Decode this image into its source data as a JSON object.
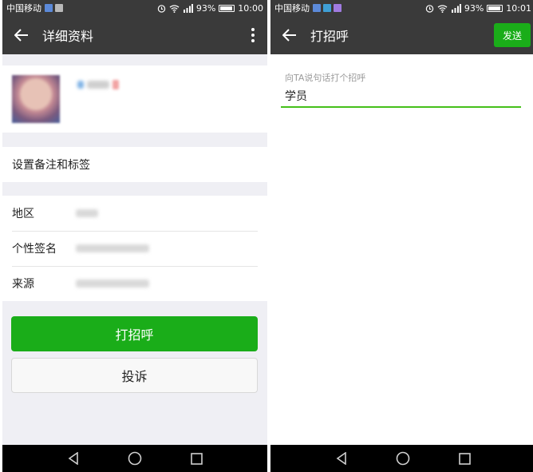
{
  "status_left": {
    "carrier": "中国移动",
    "battery": "93%",
    "time": "10:00",
    "battery_level": 0.93
  },
  "status_right": {
    "carrier": "中国移动",
    "battery": "93%",
    "time": "10:01",
    "battery_level": 0.93
  },
  "left_screen": {
    "title": "详细资料",
    "remark_label": "设置备注和标签",
    "details": [
      {
        "label": "地区"
      },
      {
        "label": "个性签名"
      },
      {
        "label": "来源"
      }
    ],
    "greet_button": "打招呼",
    "complain_button": "投诉"
  },
  "right_screen": {
    "title": "打招呼",
    "send_button": "发送",
    "input_hint": "向TA说句话打个招呼",
    "input_value": "学员"
  },
  "colors": {
    "accent_green": "#1aad19",
    "bar_dark": "#3a3a3a",
    "underline_green": "#45c01a"
  },
  "icons": [
    "back-arrow-icon",
    "more-vertical-icon",
    "nav-back-icon",
    "nav-home-icon",
    "nav-recents-icon",
    "wifi-icon",
    "signal-icon",
    "alarm-icon",
    "battery-icon"
  ]
}
